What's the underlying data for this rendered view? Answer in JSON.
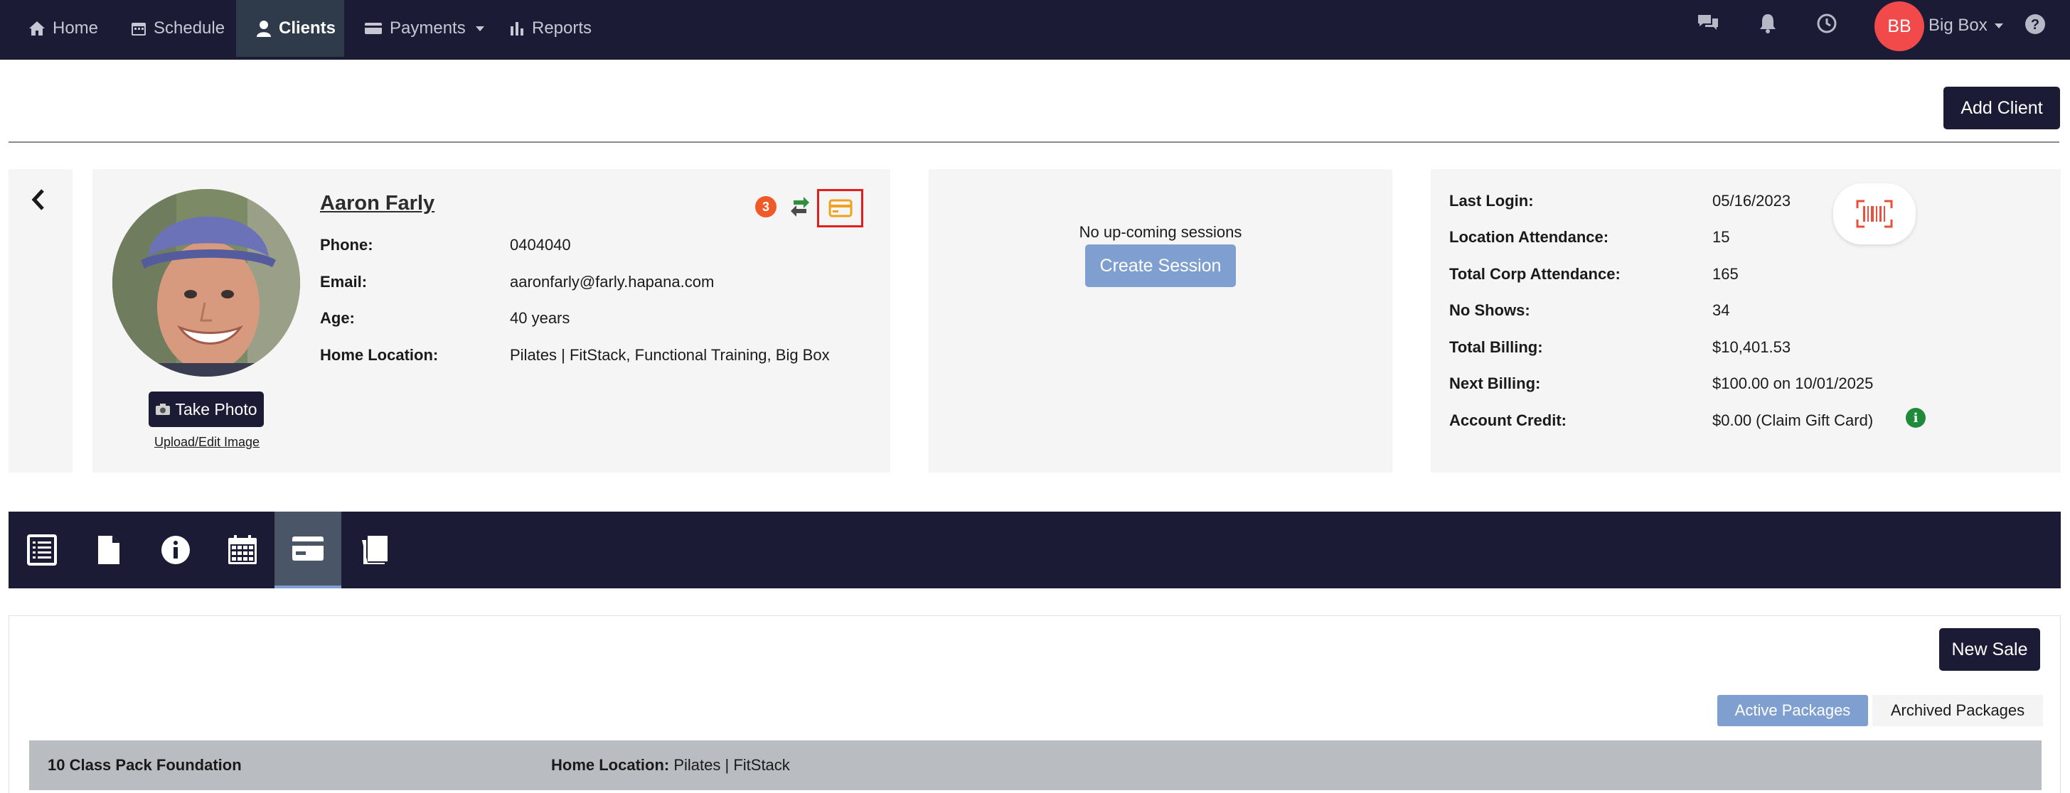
{
  "nav": {
    "items": [
      {
        "label": "Home",
        "icon": "home-icon"
      },
      {
        "label": "Schedule",
        "icon": "calendar-icon"
      },
      {
        "label": "Clients",
        "icon": "user-icon",
        "active": true
      },
      {
        "label": "Payments",
        "icon": "credit-card-icon",
        "dropdown": true
      },
      {
        "label": "Reports",
        "icon": "bar-chart-icon"
      }
    ],
    "right_icons": [
      "chat-icon",
      "bell-icon",
      "clock-icon",
      "help-icon"
    ],
    "user": {
      "initials": "BB",
      "name": "Big Box",
      "avatar_color": "#f24a4a"
    }
  },
  "toolbar": {
    "add_client_label": "Add Client"
  },
  "client": {
    "name": "Aaron Farly",
    "notification_count": "3",
    "take_photo_label": "Take Photo",
    "upload_label": "Upload/Edit Image",
    "fields": [
      {
        "label": "Phone:",
        "value": "0404040"
      },
      {
        "label": "Email:",
        "value": "aaronfarly@farly.hapana.com"
      },
      {
        "label": "Age:",
        "value": "40 years"
      },
      {
        "label": "Home Location:",
        "value": "Pilates | FitStack, Functional Training, Big Box"
      }
    ]
  },
  "sessions": {
    "empty_text": "No up-coming sessions",
    "create_label": "Create Session"
  },
  "stats": [
    {
      "label": "Last Login:",
      "value": "05/16/2023"
    },
    {
      "label": "Location Attendance:",
      "value": "15"
    },
    {
      "label": "Total Corp Attendance:",
      "value": "165"
    },
    {
      "label": "No Shows:",
      "value": "34"
    },
    {
      "label": "Total Billing:",
      "value": "$10,401.53"
    },
    {
      "label": "Next Billing:",
      "value": "$100.00 on 10/01/2025"
    },
    {
      "label": "Account Credit:",
      "value": "$0.00 (Claim Gift Card)"
    }
  ],
  "tabs": [
    {
      "icon": "list-icon"
    },
    {
      "icon": "document-icon"
    },
    {
      "icon": "info-icon"
    },
    {
      "icon": "calendar-icon"
    },
    {
      "icon": "credit-card-icon",
      "active": true
    },
    {
      "icon": "book-icon"
    }
  ],
  "packages": {
    "new_sale_label": "New Sale",
    "active_label": "Active Packages",
    "archived_label": "Archived Packages",
    "rows": [
      {
        "name": "10 Class Pack Foundation",
        "location_label": "Home Location:",
        "location_value": "Pilates | FitStack"
      }
    ]
  },
  "colors": {
    "navbar": "#1c1b36",
    "accent_blue": "#7f9fd0",
    "badge_orange": "#f05a28",
    "highlight_red": "#e41d1d",
    "info_green": "#1e8a3a"
  }
}
